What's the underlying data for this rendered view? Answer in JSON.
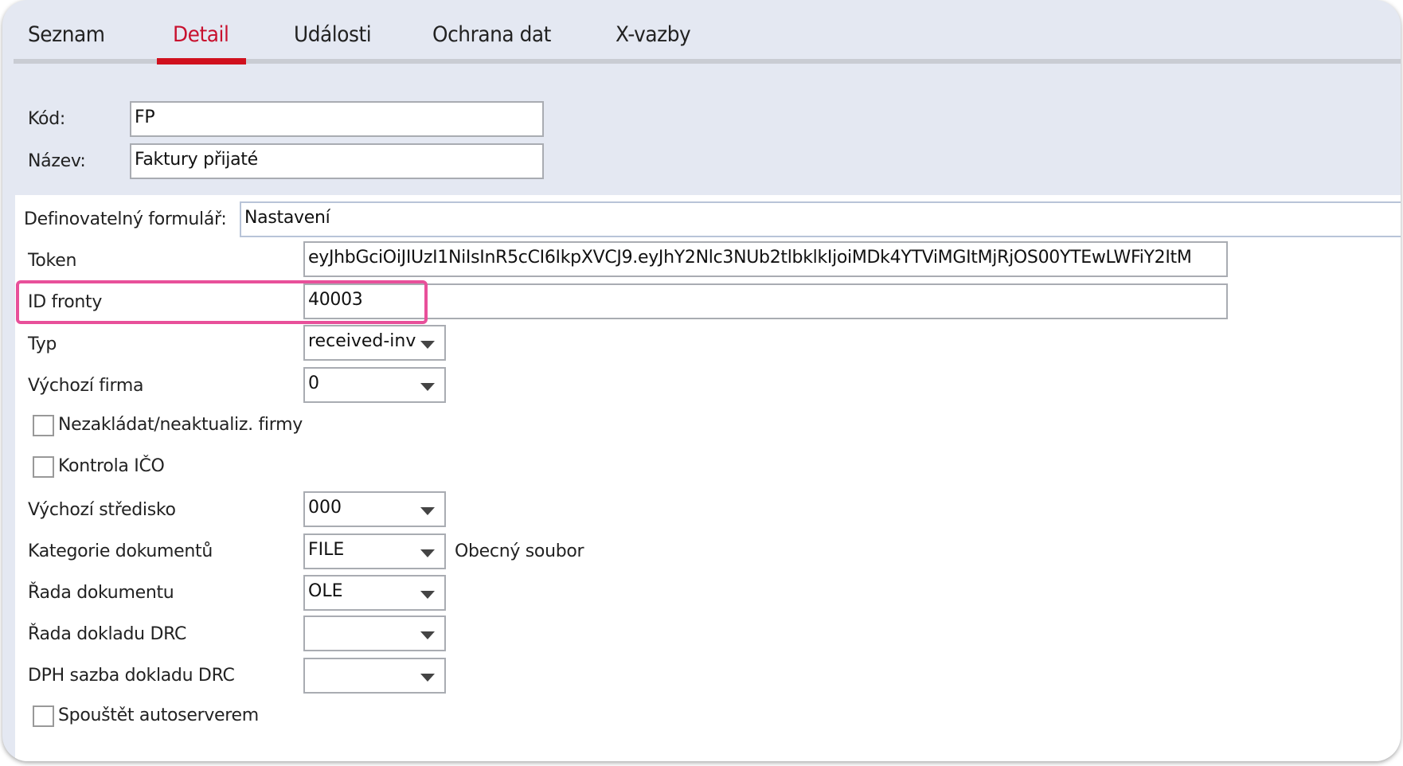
{
  "tabs": [
    {
      "label": "Seznam"
    },
    {
      "label": "Detail",
      "active": true
    },
    {
      "label": "Události"
    },
    {
      "label": "Ochrana dat"
    },
    {
      "label": "X-vazby"
    }
  ],
  "header": {
    "kod_label": "Kód:",
    "kod_value": "FP",
    "nazev_label": "Název:",
    "nazev_value": "Faktury přijaté"
  },
  "form": {
    "definovatelny_label": "Definovatelný formulář:",
    "definovatelny_value": "Nastavení",
    "token_label": "Token",
    "token_value": "eyJhbGciOiJIUzI1NiIsInR5cCI6IkpXVCJ9.eyJhY2Nlc3NUb2tlbklkIjoiMDk4YTViMGItMjRjOS00YTEwLWFiY2ItM",
    "id_fronty_label": "ID fronty",
    "id_fronty_value": "40003",
    "typ_label": "Typ",
    "typ_value": "received-inv",
    "vychozi_firma_label": "Výchozí firma",
    "vychozi_firma_value": "0",
    "nezakladat_label": "Nezakládat/neaktualiz. firmy",
    "nezakladat_checked": false,
    "kontrola_ico_label": "Kontrola IČO",
    "kontrola_ico_checked": false,
    "vychozi_stredisko_label": "Výchozí středisko",
    "vychozi_stredisko_value": "000",
    "kategorie_label": "Kategorie dokumentů",
    "kategorie_value": "FILE",
    "kategorie_desc": "Obecný soubor",
    "rada_dokumentu_label": "Řada dokumentu",
    "rada_dokumentu_value": "OLE",
    "rada_drc_label": "Řada dokladu DRC",
    "rada_drc_value": "",
    "dph_drc_label": "DPH sazba dokladu DRC",
    "dph_drc_value": "",
    "spoustet_label": "Spouštět autoserverem",
    "spoustet_checked": false
  },
  "colors": {
    "active_tab": "#c8102e",
    "highlight": "#e8509a",
    "background": "#e4e8f2"
  }
}
